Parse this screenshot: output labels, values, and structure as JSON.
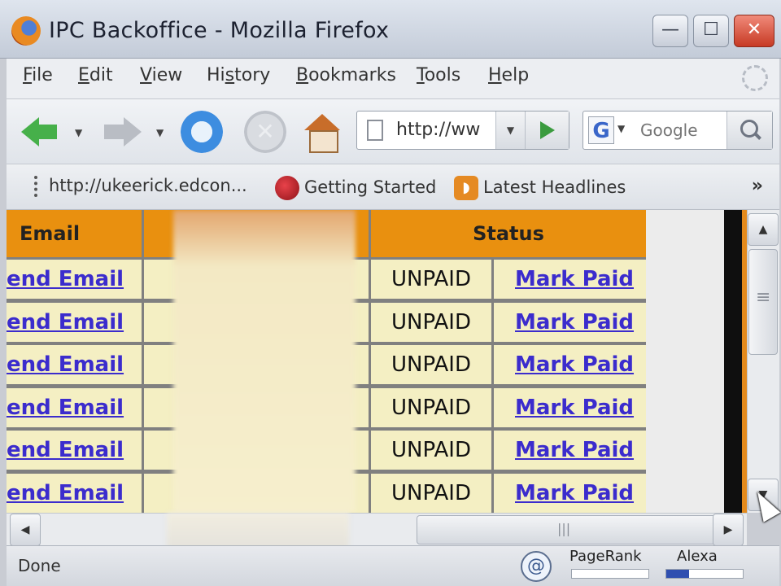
{
  "window": {
    "title": "IPC Backoffice - Mozilla Firefox",
    "min_glyph": "—",
    "max_glyph": "☐",
    "close_glyph": "✕"
  },
  "menu": [
    {
      "first": "F",
      "rest": "ile"
    },
    {
      "first": "E",
      "rest": "dit"
    },
    {
      "first": "V",
      "rest": "iew"
    },
    {
      "first": "",
      "pre": "Hi",
      "u": "s",
      "post": "tory"
    },
    {
      "first": "B",
      "rest": "ookmarks"
    },
    {
      "first": "T",
      "rest": "ools"
    },
    {
      "first": "H",
      "rest": "elp"
    }
  ],
  "toolbar": {
    "url": "http://ww",
    "search_placeholder": "Google",
    "google_letter": "G",
    "drop_glyph": "▼"
  },
  "bookmarks": {
    "items": [
      {
        "label": "http://ukeerick.edcon..."
      },
      {
        "label": "Getting Started"
      },
      {
        "label": "Latest Headlines"
      }
    ],
    "overflow": "»"
  },
  "table": {
    "headers": {
      "email": "Email",
      "status": "Status"
    },
    "rows": [
      {
        "email_link": "end Email",
        "status": "UNPAID",
        "action": "Mark Paid"
      },
      {
        "email_link": "end Email",
        "status": "UNPAID",
        "action": "Mark Paid"
      },
      {
        "email_link": "end Email",
        "status": "UNPAID",
        "action": "Mark Paid"
      },
      {
        "email_link": "end Email",
        "status": "UNPAID",
        "action": "Mark Paid"
      },
      {
        "email_link": "end Email",
        "status": "UNPAID",
        "action": "Mark Paid"
      },
      {
        "email_link": "end Email",
        "status": "UNPAID",
        "action": "Mark Paid"
      }
    ]
  },
  "scroll": {
    "up": "▲",
    "down": "▼",
    "left": "◀",
    "right": "▶"
  },
  "statusbar": {
    "text": "Done",
    "at_glyph": "@",
    "pagerank_label": "PageRank",
    "pagerank_level": 0.0,
    "alexa_label": "Alexa",
    "alexa_level": 0.3
  }
}
